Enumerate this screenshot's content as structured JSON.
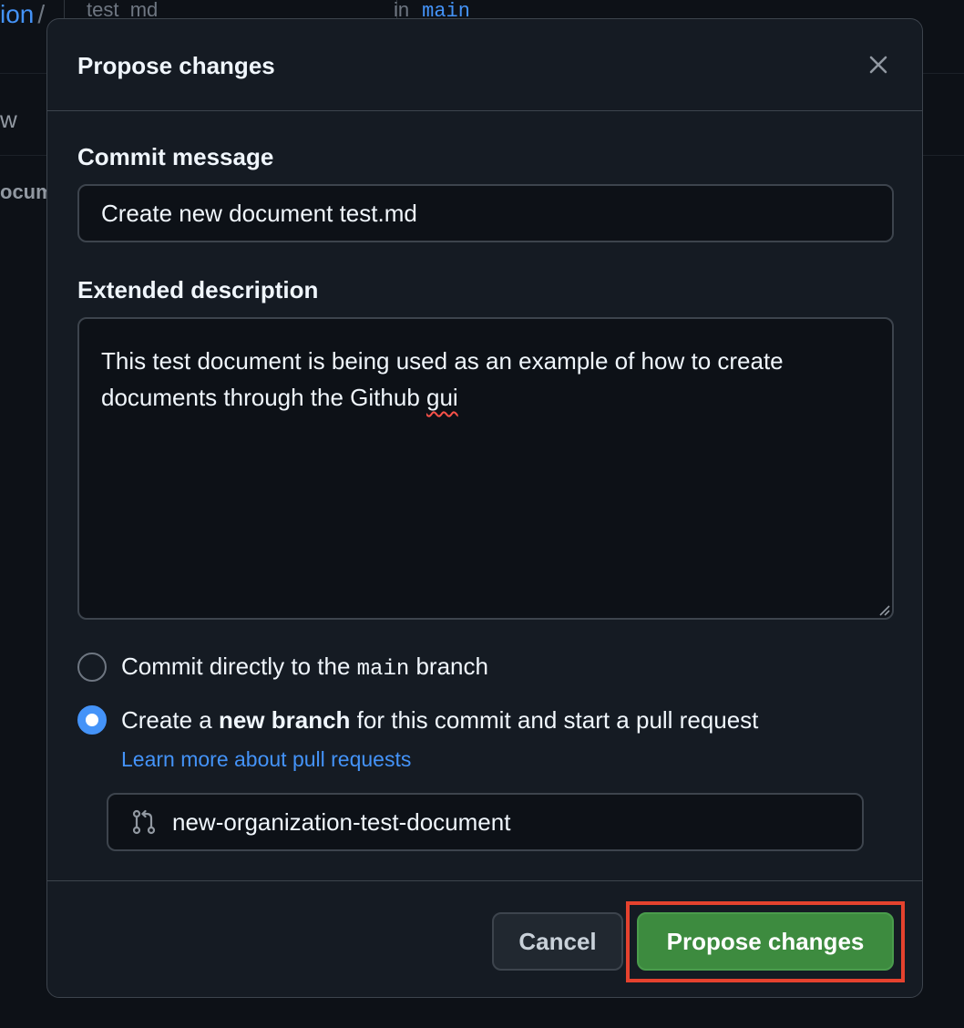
{
  "background": {
    "breadcrumb_fragment": "ion",
    "breadcrumb_separator": "/",
    "filename": "test_md",
    "in_label": "in",
    "branch": "main",
    "tab_fragment": "w",
    "doc_fragment": "ocum"
  },
  "modal": {
    "title": "Propose changes",
    "close_icon": "x-icon",
    "commit_message_label": "Commit message",
    "commit_message_value": "Create new document test.md",
    "extended_description_label": "Extended description",
    "extended_description_value_main": "This test document is being used as an example of how to create documents through the Github ",
    "extended_description_value_flagged": "gui",
    "options": {
      "direct": {
        "text_before": "Commit directly to the ",
        "branch_code": "main",
        "text_after": " branch",
        "selected": false
      },
      "new_branch": {
        "text_before": "Create a ",
        "bold": "new branch",
        "text_after": " for this commit and start a pull request",
        "selected": true
      }
    },
    "learn_more_link": "Learn more about pull requests",
    "branch_name_value": "new-organization-test-document",
    "branch_icon": "git-pull-request-icon",
    "cancel_label": "Cancel",
    "propose_label": "Propose changes"
  },
  "colors": {
    "accent_blue": "#4493f8",
    "primary_green": "#3d8b3f",
    "highlight_red": "#e5422e",
    "modal_bg": "#151b23",
    "page_bg": "#0d1117"
  }
}
